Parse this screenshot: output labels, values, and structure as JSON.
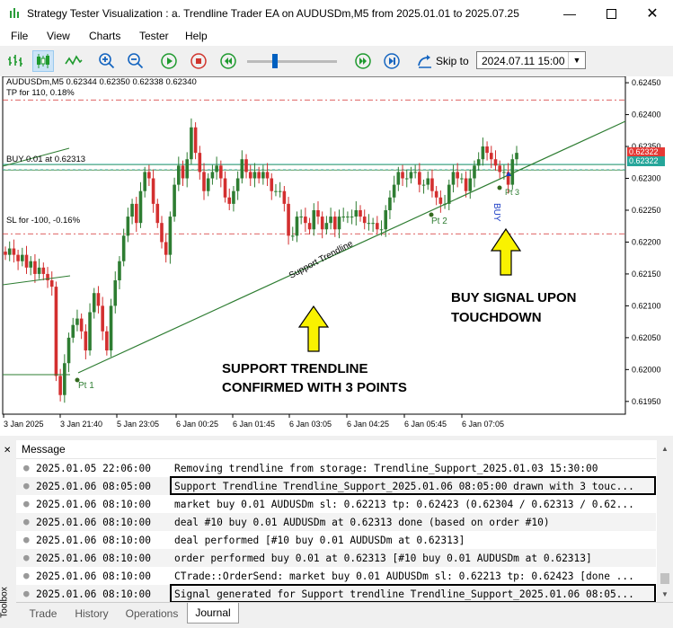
{
  "window": {
    "title": "Strategy Tester Visualization : a. Trendline Trader EA on AUDUSDm,M5 from 2025.01.01 to 2025.07.25"
  },
  "menu": [
    "File",
    "View",
    "Charts",
    "Tester",
    "Help"
  ],
  "toolbar": {
    "skip_label": "Skip to",
    "skip_date": "2024.07.11 15:00",
    "slider_position": 0.3
  },
  "chart": {
    "symbol_info": "AUDUSDm,M5  0.62344 0.62350 0.62338 0.62340",
    "tp_label": "TP for 110, 0.18%",
    "buy_label": "BUY 0.01 at 0.62313",
    "sl_label": "SL for -100, -0.16%",
    "trendline_label": "Support Trendline",
    "pt1": "Pt 1",
    "pt2": "Pt 2",
    "pt3": "Pt 3",
    "buy_marker": "BUY",
    "price_badge_red": "0.62322",
    "price_badge_teal": "0.62322",
    "annotation_support_line1": "SUPPORT TRENDLINE",
    "annotation_support_line2": "CONFIRMED WITH 3 POINTS",
    "annotation_buy_line1": "BUY SIGNAL UPON",
    "annotation_buy_line2": "TOUCHDOWN"
  },
  "chart_data": {
    "type": "candlestick",
    "y_ticks": [
      "0.62450",
      "0.62400",
      "0.62350",
      "0.62300",
      "0.62250",
      "0.62200",
      "0.62150",
      "0.62100",
      "0.62050",
      "0.62000",
      "0.61950"
    ],
    "x_ticks": [
      "3 Jan 2025",
      "3 Jan 21:40",
      "5 Jan 23:05",
      "6 Jan 00:25",
      "6 Jan 01:45",
      "6 Jan 03:05",
      "6 Jan 04:25",
      "6 Jan 05:45",
      "6 Jan 07:05"
    ],
    "ylim": [
      0.6193,
      0.6246
    ],
    "levels": {
      "tp": 0.62423,
      "buy": 0.62313,
      "sl": 0.62213,
      "current": 0.62322
    },
    "closes": [
      0.6218,
      0.6219,
      0.6218,
      0.6217,
      0.6218,
      0.6216,
      0.6217,
      0.6215,
      0.6216,
      0.6215,
      0.6214,
      0.6213,
      0.6199,
      0.6196,
      0.6201,
      0.6205,
      0.6207,
      0.6208,
      0.6206,
      0.6203,
      0.6209,
      0.6212,
      0.621,
      0.6206,
      0.6203,
      0.621,
      0.6214,
      0.6217,
      0.6221,
      0.6224,
      0.6226,
      0.6223,
      0.6228,
      0.6231,
      0.623,
      0.6226,
      0.6223,
      0.622,
      0.6218,
      0.6224,
      0.6229,
      0.6232,
      0.623,
      0.6233,
      0.6238,
      0.6234,
      0.6231,
      0.6228,
      0.623,
      0.6231,
      0.6232,
      0.623,
      0.6227,
      0.6226,
      0.6228,
      0.623,
      0.6233,
      0.6231,
      0.623,
      0.6231,
      0.623,
      0.6231,
      0.623,
      0.6228,
      0.6228,
      0.6228,
      0.6226,
      0.6221,
      0.6221,
      0.6224,
      0.6224,
      0.6223,
      0.6222,
      0.6225,
      0.6224,
      0.6222,
      0.6223,
      0.6224,
      0.6222,
      0.6224,
      0.6224,
      0.6224,
      0.6224,
      0.6225,
      0.6224,
      0.6223,
      0.6223,
      0.6223,
      0.6222,
      0.6222,
      0.6225,
      0.6227,
      0.6229,
      0.6231,
      0.623,
      0.623,
      0.6231,
      0.6231,
      0.6229,
      0.6229,
      0.623,
      0.6228,
      0.6227,
      0.6226,
      0.6226,
      0.6229,
      0.6231,
      0.623,
      0.623,
      0.6228,
      0.623,
      0.6232,
      0.6233,
      0.6235,
      0.6234,
      0.6233,
      0.6232,
      0.6231,
      0.6231,
      0.6229,
      0.6233,
      0.6234
    ]
  },
  "journal": {
    "header": "Message",
    "rows": [
      {
        "time": "2025.01.05 22:06:00",
        "msg": "Removing trendline from storage: Trendline_Support_2025.01.03 15:30:00"
      },
      {
        "time": "2025.01.06 08:05:00",
        "msg": "Support Trendline Trendline_Support_2025.01.06 08:05:00 drawn with 3 touc...",
        "boxed": true
      },
      {
        "time": "2025.01.06 08:10:00",
        "msg": "market buy 0.01 AUDUSDm sl: 0.62213 tp: 0.62423 (0.62304 / 0.62313 / 0.62..."
      },
      {
        "time": "2025.01.06 08:10:00",
        "msg": "deal #10 buy 0.01 AUDUSDm at 0.62313 done (based on order #10)"
      },
      {
        "time": "2025.01.06 08:10:00",
        "msg": "deal performed [#10 buy 0.01 AUDUSDm at 0.62313]"
      },
      {
        "time": "2025.01.06 08:10:00",
        "msg": "order performed buy 0.01 at 0.62313 [#10 buy 0.01 AUDUSDm at 0.62313]"
      },
      {
        "time": "2025.01.06 08:10:00",
        "msg": "CTrade::OrderSend: market buy 0.01 AUDUSDm sl: 0.62213 tp: 0.62423 [done ..."
      },
      {
        "time": "2025.01.06 08:10:00",
        "msg": "Signal generated for Support trendline Trendline_Support_2025.01.06 08:05...",
        "boxed": true
      }
    ]
  },
  "tabs": [
    "Trade",
    "History",
    "Operations",
    "Journal"
  ],
  "active_tab": "Journal",
  "toolbox_label": "Toolbox"
}
